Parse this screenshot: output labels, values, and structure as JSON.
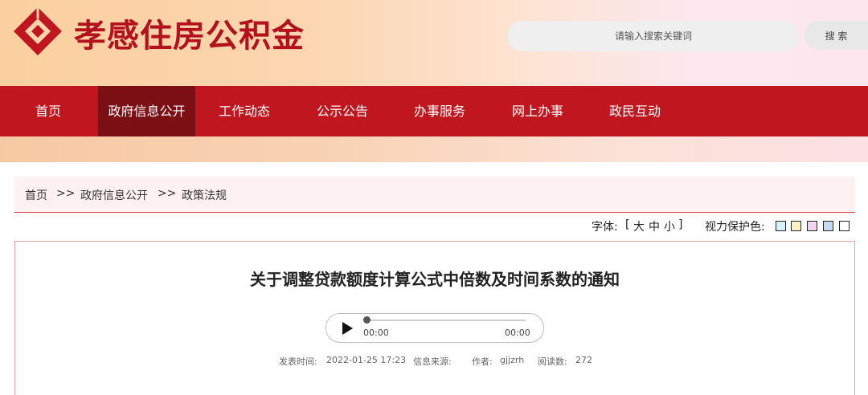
{
  "header": {
    "site_title": "孝感住房公积金",
    "search_placeholder": "请输入搜索关键词",
    "search_button": "搜 索"
  },
  "nav": {
    "items": [
      "首页",
      "政府信息公开",
      "工作动态",
      "公示公告",
      "办事服务",
      "网上办事",
      "政民互动"
    ],
    "active_index": 1
  },
  "breadcrumb": {
    "home": "首页",
    "sep1": ">>",
    "level1": "政府信息公开",
    "sep2": ">>",
    "level2": "政策法规"
  },
  "tools": {
    "font_label": "字体:",
    "font_open": "[",
    "font_large": "大",
    "font_medium": "中",
    "font_small": "小",
    "font_close": "]",
    "eye_label": "视力保护色:",
    "swatches": [
      "#d7f1f6",
      "#f7f3c4",
      "#f3d4ee",
      "#c8d9f2",
      "#ffffff"
    ]
  },
  "article": {
    "title": "关于调整贷款额度计算公式中倍数及时间系数的通知",
    "audio_current": "00:00",
    "audio_duration": "00:00",
    "audio_progress": 0,
    "meta": {
      "publish_label": "发表时间:",
      "publish_time": "2022-01-25 17:23",
      "source_label": "信息来源:",
      "author_label": "作者:",
      "author": "gjjzrh",
      "reads_label": "阅读数:",
      "reads": "272"
    }
  },
  "colors": {
    "brand_red": "#c0161f",
    "nav_active": "#7b0f14"
  }
}
